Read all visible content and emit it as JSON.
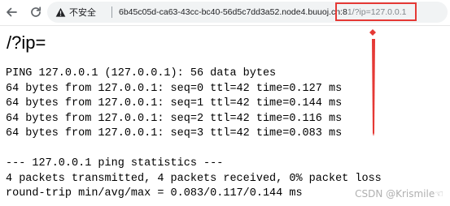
{
  "browser": {
    "security_label": "不安全",
    "url_host": "6b45c05d-ca63-43cc-bc40-56d5c7dd3a52.node4.buuoj.cn:8",
    "url_query": "1/?ip=127.0.0.1",
    "icons": {
      "back": "back-arrow-icon",
      "reload": "reload-icon",
      "warning": "warning-triangle-icon"
    }
  },
  "annotation": {
    "color": "#e53935"
  },
  "page": {
    "heading": "/?ip=",
    "output_lines": [
      "PING 127.0.0.1 (127.0.0.1): 56 data bytes",
      "64 bytes from 127.0.0.1: seq=0 ttl=42 time=0.127 ms",
      "64 bytes from 127.0.0.1: seq=1 ttl=42 time=0.144 ms",
      "64 bytes from 127.0.0.1: seq=2 ttl=42 time=0.116 ms",
      "64 bytes from 127.0.0.1: seq=3 ttl=42 time=0.083 ms",
      "",
      "--- 127.0.0.1 ping statistics ---",
      "4 packets transmitted, 4 packets received, 0% packet loss",
      "round-trip min/avg/max = 0.083/0.117/0.144 ms"
    ]
  },
  "watermark": "CSDN @Krismile☜"
}
